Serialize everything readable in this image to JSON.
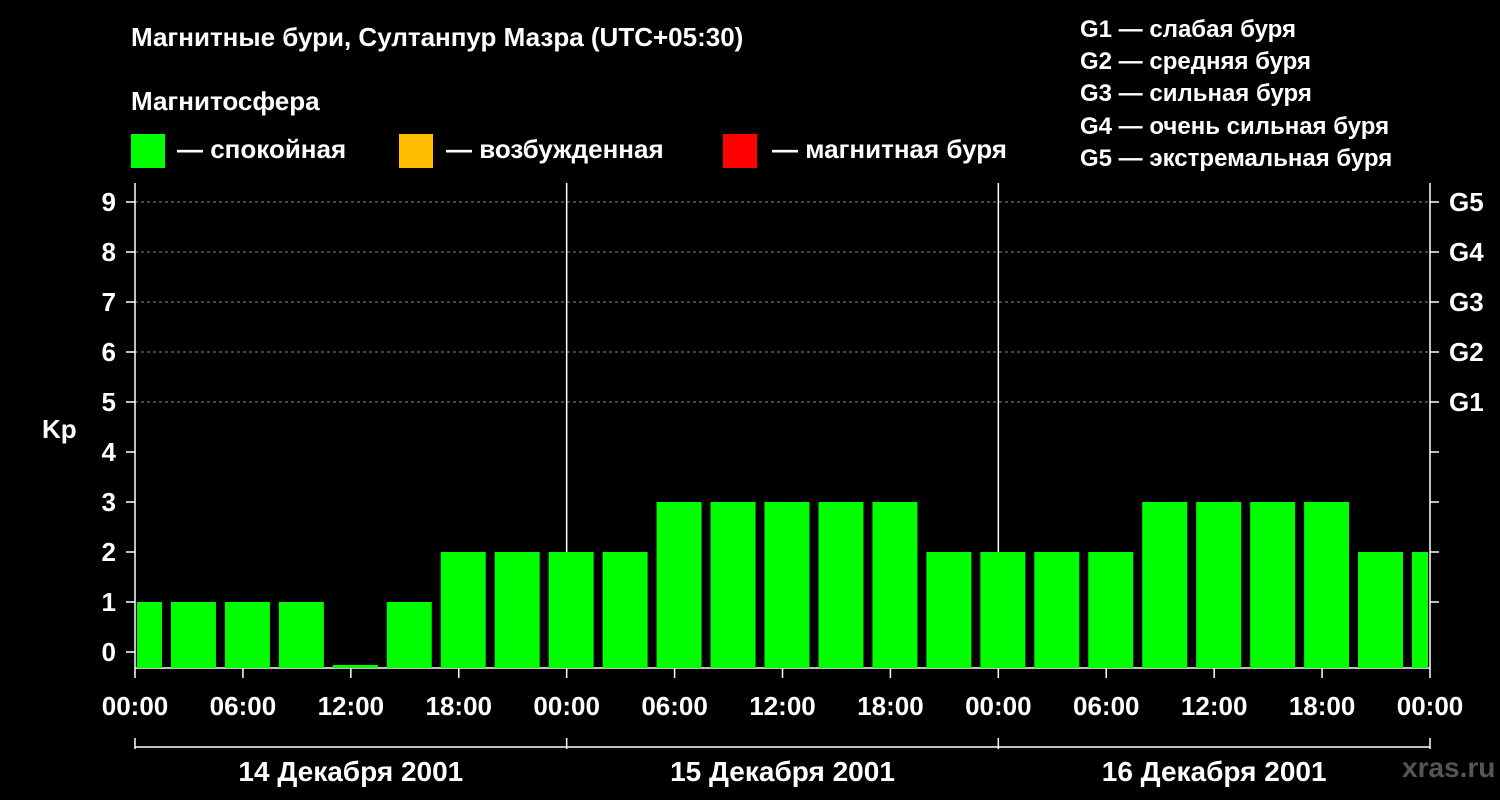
{
  "title": "Магнитные бури, Султанпур Мазра (UTC+05:30)",
  "magnetosphere_title": "Магнитосфера",
  "legend": [
    {
      "label": "— спокойная",
      "color": "#00ff00"
    },
    {
      "label": "— возбужденная",
      "color": "#ffbf00"
    },
    {
      "label": "— магнитная буря",
      "color": "#ff0000"
    }
  ],
  "g_levels": [
    "G1 — слабая буря",
    "G2 — средняя буря",
    "G3 — сильная буря",
    "G4 — очень сильная буря",
    "G5 — экстремальная буря"
  ],
  "watermark": "xras.ru",
  "chart_data": {
    "type": "bar",
    "ylabel": "Kp",
    "ylim": [
      0,
      9
    ],
    "yticks": [
      "0",
      "1",
      "2",
      "3",
      "4",
      "5",
      "6",
      "7",
      "8",
      "9"
    ],
    "right_ticks": [
      {
        "kp": 5,
        "label": "G1"
      },
      {
        "kp": 6,
        "label": "G2"
      },
      {
        "kp": 7,
        "label": "G3"
      },
      {
        "kp": 8,
        "label": "G4"
      },
      {
        "kp": 9,
        "label": "G5"
      }
    ],
    "xticks": [
      "00:00",
      "06:00",
      "12:00",
      "18:00",
      "00:00",
      "06:00",
      "12:00",
      "18:00",
      "00:00",
      "06:00",
      "12:00",
      "18:00",
      "00:00"
    ],
    "days": [
      "14 Декабря 2001",
      "15 Декабря 2001",
      "16 Декабря 2001"
    ],
    "bar_color": "#00ff00",
    "bars": [
      {
        "start": "14 Декабря 2001 00:00",
        "end": "14 Декабря 2001 01:30",
        "kp": 1
      },
      {
        "start": "14 Декабря 2001 02:00",
        "end": "14 Декабря 2001 04:30",
        "kp": 1
      },
      {
        "start": "14 Декабря 2001 05:00",
        "end": "14 Декабря 2001 07:30",
        "kp": 1
      },
      {
        "start": "14 Декабря 2001 08:00",
        "end": "14 Декабря 2001 10:30",
        "kp": 1
      },
      {
        "start": "14 Декабря 2001 11:00",
        "end": "14 Декабря 2001 13:30",
        "kp": 0
      },
      {
        "start": "14 Декабря 2001 14:00",
        "end": "14 Декабря 2001 16:30",
        "kp": 1
      },
      {
        "start": "14 Декабря 2001 17:00",
        "end": "14 Декабря 2001 19:30",
        "kp": 2
      },
      {
        "start": "14 Декабря 2001 20:00",
        "end": "14 Декабря 2001 22:30",
        "kp": 2
      },
      {
        "start": "14 Декабря 2001 23:00",
        "end": "15 Декабря 2001 01:30",
        "kp": 2
      },
      {
        "start": "15 Декабря 2001 02:00",
        "end": "15 Декабря 2001 04:30",
        "kp": 2
      },
      {
        "start": "15 Декабря 2001 05:00",
        "end": "15 Декабря 2001 07:30",
        "kp": 3
      },
      {
        "start": "15 Декабря 2001 08:00",
        "end": "15 Декабря 2001 10:30",
        "kp": 3
      },
      {
        "start": "15 Декабря 2001 11:00",
        "end": "15 Декабря 2001 13:30",
        "kp": 3
      },
      {
        "start": "15 Декабря 2001 14:00",
        "end": "15 Декабря 2001 16:30",
        "kp": 3
      },
      {
        "start": "15 Декабря 2001 17:00",
        "end": "15 Декабря 2001 19:30",
        "kp": 3
      },
      {
        "start": "15 Декабря 2001 20:00",
        "end": "15 Декабря 2001 22:30",
        "kp": 2
      },
      {
        "start": "15 Декабря 2001 23:00",
        "end": "16 Декабря 2001 01:30",
        "kp": 2
      },
      {
        "start": "16 Декабря 2001 02:00",
        "end": "16 Декабря 2001 04:30",
        "kp": 2
      },
      {
        "start": "16 Декабря 2001 05:00",
        "end": "16 Декабря 2001 07:30",
        "kp": 2
      },
      {
        "start": "16 Декабря 2001 08:00",
        "end": "16 Декабря 2001 10:30",
        "kp": 3
      },
      {
        "start": "16 Декабря 2001 11:00",
        "end": "16 Декабря 2001 13:30",
        "kp": 3
      },
      {
        "start": "16 Декабря 2001 14:00",
        "end": "16 Декабря 2001 16:30",
        "kp": 3
      },
      {
        "start": "16 Декабря 2001 17:00",
        "end": "16 Декабря 2001 19:30",
        "kp": 3
      },
      {
        "start": "16 Декабря 2001 20:00",
        "end": "16 Декабря 2001 22:30",
        "kp": 2
      },
      {
        "start": "16 Декабря 2001 23:00",
        "end": "17 Декабря 2001 00:00",
        "kp": 2
      }
    ],
    "grid": true
  }
}
